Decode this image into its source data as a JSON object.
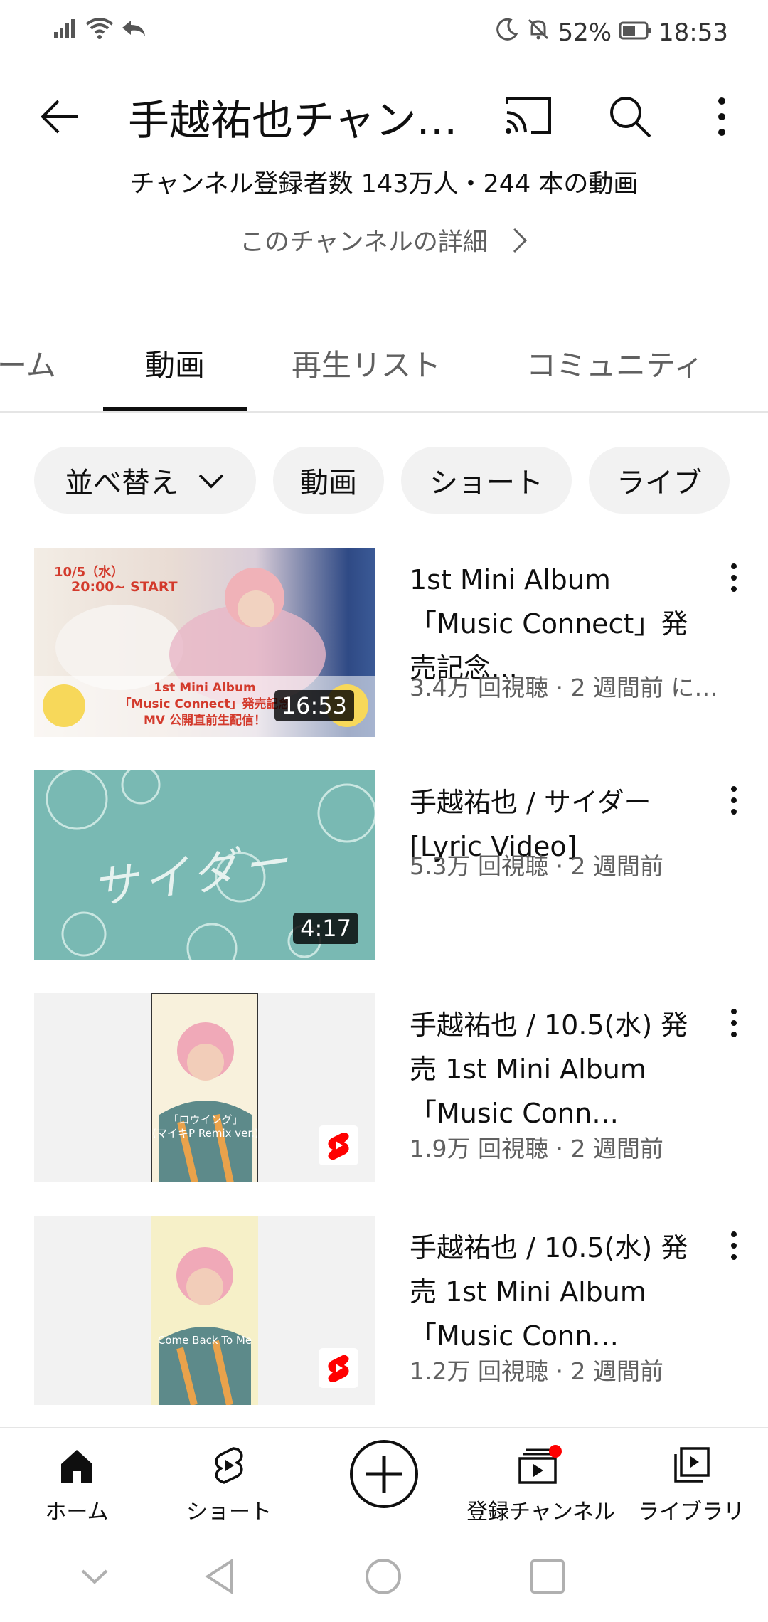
{
  "status_bar": {
    "battery": "52%",
    "time": "18:53",
    "icons": [
      "signal-icon",
      "wifi-icon",
      "back-arrow-icon",
      "moon-icon",
      "mute-bell-icon",
      "battery-icon"
    ]
  },
  "header": {
    "title": "手越祐也チャン…",
    "icons": [
      "back-icon",
      "cast-icon",
      "search-icon",
      "more-vert-icon"
    ]
  },
  "channel": {
    "subscribers_info": "チャンネル登録者数 143万人・244 本の動画",
    "details_link": "このチャンネルの詳細"
  },
  "tabs": [
    {
      "label": "ーム"
    },
    {
      "label": "動画",
      "active": true
    },
    {
      "label": "再生リスト"
    },
    {
      "label": "コミュニティ"
    }
  ],
  "chips": {
    "sort": "並べ替え",
    "videos": "動画",
    "shorts": "ショート",
    "live": "ライブ"
  },
  "videos": [
    {
      "title": "1st Mini Album「Music Connect」発売記念…",
      "meta": "3.4万 回視聴 · 2 週間前 に…",
      "duration": "16:53",
      "thumb_text": {
        "date": "10/5（水）",
        "time": "20:00~ START",
        "line1": "1st Mini Album",
        "line2": "「Music Connect」発売記念",
        "line3": "MV 公開直前生配信！"
      }
    },
    {
      "title": "手越祐也 / サイダー [Lyric Video]",
      "meta": "5.3万 回視聴 · 2 週間前",
      "duration": "4:17",
      "thumb_text": {
        "word": "サイダー"
      }
    },
    {
      "title": "手越祐也 / 10.5(水) 発売 1st Mini Album「Music Conn…",
      "meta": "1.9万 回視聴 · 2 週間前",
      "thumb_text": {
        "line1": "「ロウイング」",
        "line2": "(マイキP Remix ver.)"
      }
    },
    {
      "title": "手越祐也 / 10.5(水) 発売 1st Mini Album「Music Conn…",
      "meta": "1.2万 回視聴 · 2 週間前",
      "thumb_text": {
        "line1": "Come Back To Me"
      }
    }
  ],
  "bottom_nav": {
    "home": "ホーム",
    "shorts": "ショート",
    "subscriptions": "登録チャンネル",
    "library": "ライブラリ"
  }
}
